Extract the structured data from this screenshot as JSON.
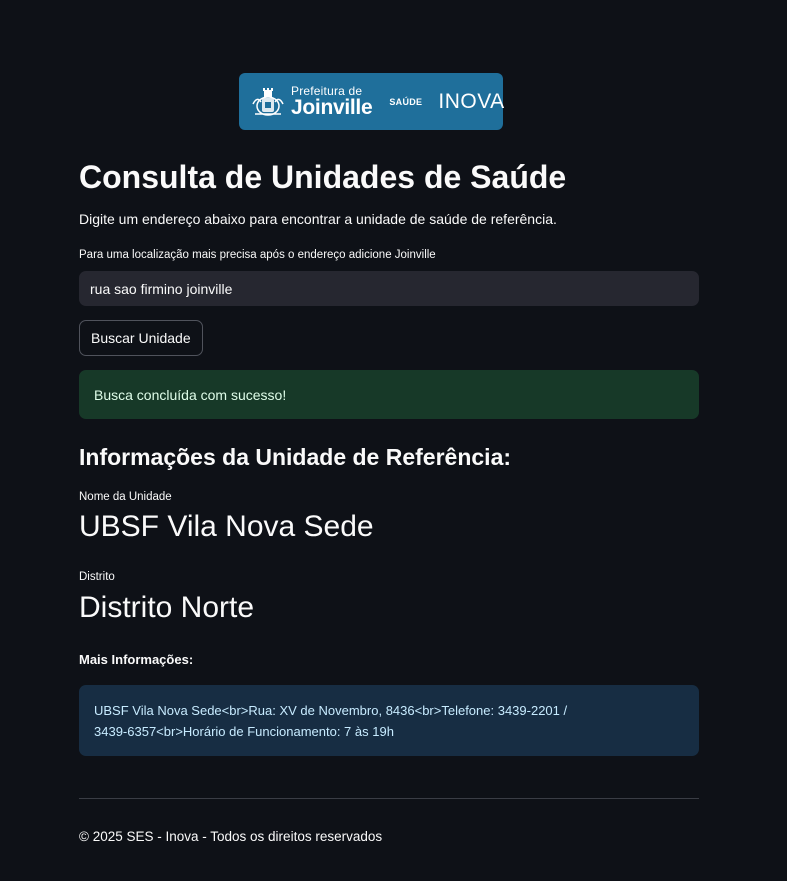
{
  "logo": {
    "prefeitura_small": "Prefeitura de",
    "prefeitura_big": "Joinville",
    "saude": "SAÚDE",
    "inova": "INOVA"
  },
  "header": {
    "title": "Consulta de Unidades de Saúde",
    "intro": "Digite um endereço abaixo para encontrar a unidade de saúde de referência."
  },
  "search": {
    "label": "Para uma localização mais precisa após o endereço adicione Joinville",
    "value": "rua sao firmino joinville",
    "button_label": "Buscar Unidade"
  },
  "alert": {
    "success_message": "Busca concluída com sucesso!"
  },
  "result": {
    "section_title": "Informações da Unidade de Referência:",
    "unit_label": "Nome da Unidade",
    "unit_value": "UBSF Vila Nova Sede",
    "district_label": "Distrito",
    "district_value": "Distrito Norte",
    "more_info_label": "Mais Informações:",
    "more_info_text": "UBSF Vila Nova Sede<br>Rua: XV de Novembro, 8436<br>Telefone: 3439-2201 / 3439-6357<br>Horário de Funcionamento: 7 às 19h"
  },
  "footer": {
    "text": "© 2025 SES - Inova - Todos os direitos reservados"
  },
  "colors": {
    "background": "#0e1117",
    "logo_blue": "#1f6f9b",
    "input_bg": "#262730",
    "success_bg": "#173928",
    "info_bg": "#172d43"
  }
}
